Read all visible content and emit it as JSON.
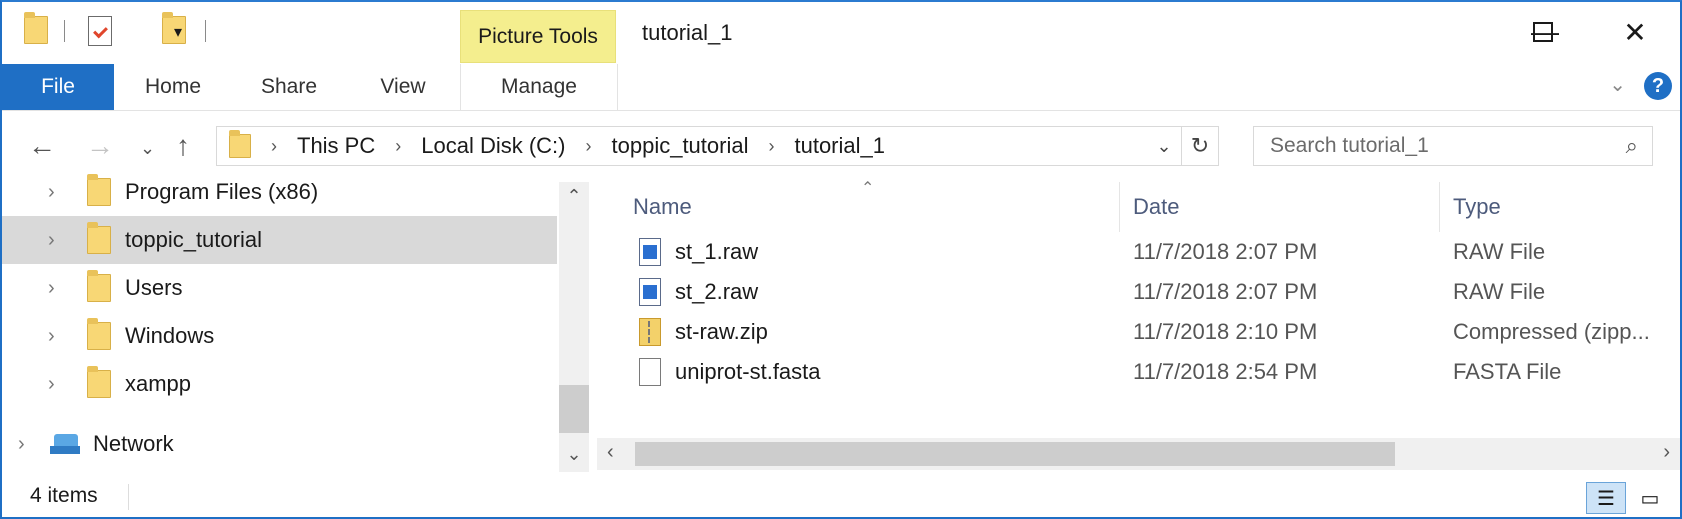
{
  "window": {
    "title": "tutorial_1",
    "context_tab": "Picture Tools",
    "controls": {
      "minimize": "—",
      "maximize": "☐",
      "close": "✕"
    }
  },
  "ribbon": {
    "tabs": [
      "File",
      "Home",
      "Share",
      "View",
      "Manage"
    ],
    "help": "?"
  },
  "address": {
    "crumbs": [
      "This PC",
      "Local Disk (C:)",
      "toppic_tutorial",
      "tutorial_1"
    ]
  },
  "search": {
    "placeholder": "Search tutorial_1"
  },
  "tree": {
    "items": [
      {
        "label": "Program Files (x86)"
      },
      {
        "label": "toppic_tutorial",
        "selected": true
      },
      {
        "label": "Users"
      },
      {
        "label": "Windows"
      },
      {
        "label": "xampp"
      }
    ],
    "network": "Network"
  },
  "columns": {
    "name": "Name",
    "date": "Date",
    "type": "Type"
  },
  "files": [
    {
      "name": "st_1.raw",
      "date": "11/7/2018 2:07 PM",
      "type": "RAW File",
      "icon": "raw-file-icon"
    },
    {
      "name": "st_2.raw",
      "date": "11/7/2018 2:07 PM",
      "type": "RAW File",
      "icon": "raw-file-icon"
    },
    {
      "name": "st-raw.zip",
      "date": "11/7/2018 2:10 PM",
      "type": "Compressed (zipp...",
      "icon": "zip-file-icon"
    },
    {
      "name": "uniprot-st.fasta",
      "date": "11/7/2018 2:54 PM",
      "type": "FASTA File",
      "icon": "fasta-file-icon"
    }
  ],
  "status": {
    "count": "4 items"
  },
  "colors": {
    "accent": "#1f6fc5",
    "context_tab_bg": "#f4ee8e",
    "selection": "#d9d9d9"
  }
}
